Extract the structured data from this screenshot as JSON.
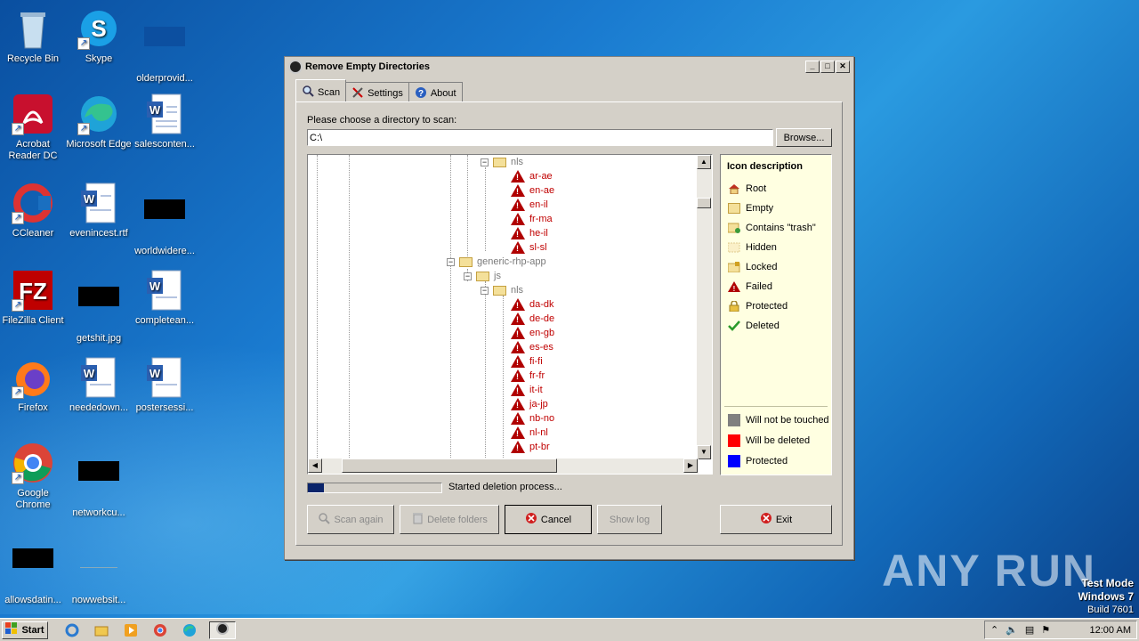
{
  "desktop": {
    "icons": [
      {
        "label": "Recycle Bin"
      },
      {
        "label": "Skype"
      },
      {
        "label": "olderprovid..."
      },
      {
        "label": "Acrobat Reader DC"
      },
      {
        "label": "Microsoft Edge"
      },
      {
        "label": "salesconten..."
      },
      {
        "label": "CCleaner"
      },
      {
        "label": "evenincest.rtf"
      },
      {
        "label": "worldwidere..."
      },
      {
        "label": "FileZilla Client"
      },
      {
        "label": "getshit.jpg"
      },
      {
        "label": "completean..."
      },
      {
        "label": "Firefox"
      },
      {
        "label": "neededown..."
      },
      {
        "label": "postersessi..."
      },
      {
        "label": "Google Chrome"
      },
      {
        "label": "networkcu..."
      },
      {
        "label": "allowsdatin..."
      },
      {
        "label": "nowwebsit..."
      }
    ]
  },
  "window": {
    "title": "Remove Empty Directories",
    "controls": {
      "minimize": "_",
      "maximize": "□",
      "close": "✕"
    },
    "tabs": [
      {
        "label": "Scan",
        "icon": "magnifier-icon"
      },
      {
        "label": "Settings",
        "icon": "tools-icon"
      },
      {
        "label": "About",
        "icon": "help-icon"
      }
    ],
    "choose_label": "Please choose a directory to scan:",
    "directory": "C:\\",
    "browse_label": "Browse...",
    "tree": [
      {
        "label": "nls",
        "kind": "folder"
      },
      {
        "label": "ar-ae",
        "kind": "failed"
      },
      {
        "label": "en-ae",
        "kind": "failed"
      },
      {
        "label": "en-il",
        "kind": "failed"
      },
      {
        "label": "fr-ma",
        "kind": "failed"
      },
      {
        "label": "he-il",
        "kind": "failed"
      },
      {
        "label": "sl-sl",
        "kind": "failed"
      },
      {
        "label": "generic-rhp-app",
        "kind": "folder"
      },
      {
        "label": "js",
        "kind": "folder"
      },
      {
        "label": "nls",
        "kind": "folder"
      },
      {
        "label": "da-dk",
        "kind": "failed"
      },
      {
        "label": "de-de",
        "kind": "failed"
      },
      {
        "label": "en-gb",
        "kind": "failed"
      },
      {
        "label": "es-es",
        "kind": "failed"
      },
      {
        "label": "fi-fi",
        "kind": "failed"
      },
      {
        "label": "fr-fr",
        "kind": "failed"
      },
      {
        "label": "it-it",
        "kind": "failed"
      },
      {
        "label": "ja-jp",
        "kind": "failed"
      },
      {
        "label": "nb-no",
        "kind": "failed"
      },
      {
        "label": "nl-nl",
        "kind": "failed"
      },
      {
        "label": "pt-br",
        "kind": "failed"
      }
    ],
    "legend": {
      "title": "Icon description",
      "items": [
        {
          "label": "Root",
          "icon": "root-house-icon"
        },
        {
          "label": "Empty",
          "icon": "empty-folder-icon"
        },
        {
          "label": "Contains \"trash\"",
          "icon": "trash-folder-icon"
        },
        {
          "label": "Hidden",
          "icon": "hidden-folder-icon"
        },
        {
          "label": "Locked",
          "icon": "locked-folder-icon"
        },
        {
          "label": "Failed",
          "icon": "failed-warning-icon"
        },
        {
          "label": "Protected",
          "icon": "protected-lock-icon"
        },
        {
          "label": "Deleted",
          "icon": "deleted-check-icon"
        }
      ],
      "colors": [
        {
          "label": "Will not be touched",
          "color": "#808080"
        },
        {
          "label": "Will be deleted",
          "color": "#ff0000"
        },
        {
          "label": "Protected",
          "color": "#0000ff"
        }
      ]
    },
    "progress": 0.12,
    "status": "Started deletion process...",
    "buttons": {
      "scan_again": "Scan again",
      "delete_folders": "Delete folders",
      "cancel": "Cancel",
      "show_log": "Show log",
      "exit": "Exit"
    }
  },
  "taskbar": {
    "start_label": "Start",
    "clock": "12:00 AM"
  },
  "watermark": "ANY RUN",
  "testmode": {
    "line1": "Test Mode",
    "line2": "Windows 7",
    "line3": "Build 7601"
  }
}
